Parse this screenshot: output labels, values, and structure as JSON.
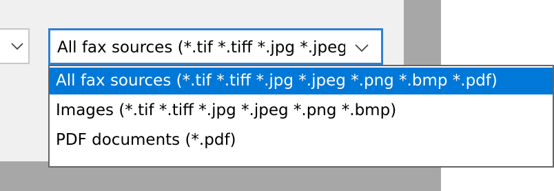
{
  "combo": {
    "selected": "All fax sources (*.tif *.tiff *.jpg *.jpeg *.png *.bmp *.pdf)"
  },
  "dropdown": {
    "options": [
      {
        "label": "All fax sources (*.tif *.tiff *.jpg *.jpeg *.png *.bmp *.pdf)",
        "selected": true
      },
      {
        "label": "Images (*.tif *.tiff *.jpg *.jpeg *.png *.bmp)",
        "selected": false
      },
      {
        "label": "PDF documents (*.pdf)",
        "selected": false
      }
    ]
  },
  "icons": {
    "left_combo_chevron": "chevron-down-icon",
    "file_type_chevron": "chevron-down-icon"
  },
  "colors": {
    "selection": "#0078d7",
    "focus_border": "#2f7fd2",
    "dialog_background": "#f0f0f0",
    "backdrop_gray": "#a7a7a7"
  }
}
